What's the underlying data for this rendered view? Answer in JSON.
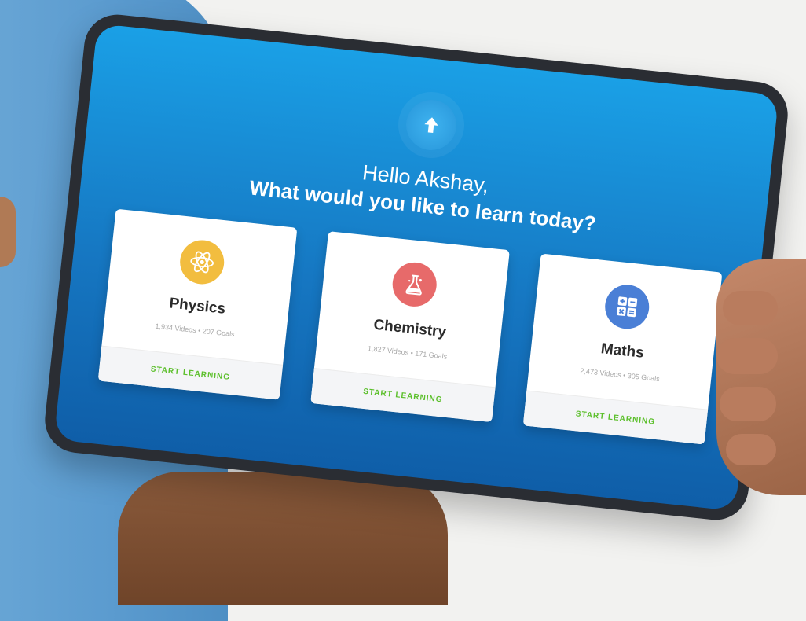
{
  "greeting": "Hello Akshay,",
  "question": "What would you like to learn today?",
  "logo_icon": "arrow-up-icon",
  "subjects": [
    {
      "title": "Physics",
      "stats": "1,934 Videos • 207 Goals",
      "cta": "START LEARNING",
      "icon": "atom-icon",
      "color": "#f2bd3f"
    },
    {
      "title": "Chemistry",
      "stats": "1,827 Videos • 171 Goals",
      "cta": "START LEARNING",
      "icon": "flask-icon",
      "color": "#e76a6a"
    },
    {
      "title": "Maths",
      "stats": "2,473 Videos • 305 Goals",
      "cta": "START LEARNING",
      "icon": "calculator-icon",
      "color": "#4a7fd6"
    }
  ],
  "colors": {
    "screen_top": "#1aa0e6",
    "screen_bottom": "#0f5ea8",
    "cta_green": "#5bbf2a"
  }
}
